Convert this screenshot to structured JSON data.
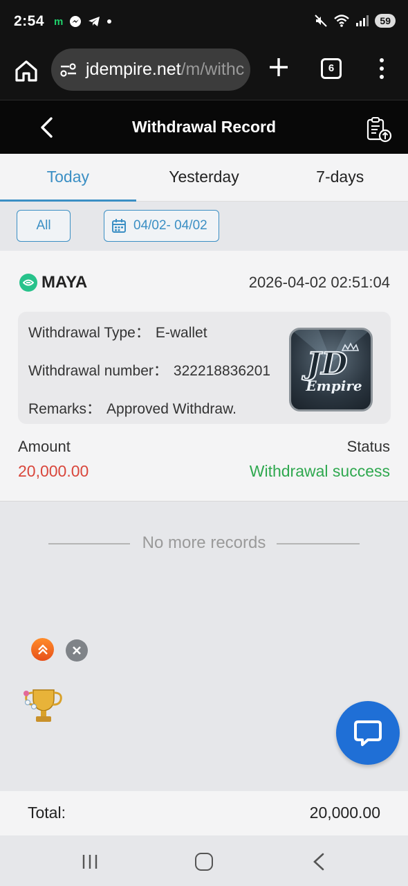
{
  "status_bar": {
    "time": "2:54",
    "app_icons": [
      "m",
      "messenger-icon",
      "telegram-icon",
      "dot"
    ],
    "battery": "59"
  },
  "browser": {
    "url_domain": "jdempire.net",
    "url_path": "/m/withc",
    "tab_count": "6"
  },
  "header": {
    "title": "Withdrawal Record"
  },
  "tabs": [
    {
      "label": "Today",
      "active": true
    },
    {
      "label": "Yesterday",
      "active": false
    },
    {
      "label": "7-days",
      "active": false
    }
  ],
  "filters": {
    "all_label": "All",
    "date_range": "04/02- 04/02"
  },
  "record": {
    "provider": "MAYA",
    "datetime": "2026-04-02 02:51:04",
    "type_label": "Withdrawal Type：",
    "type_value": "E-wallet",
    "number_label": "Withdrawal number：",
    "number_value": "322218836201",
    "remarks_label": "Remarks：",
    "remarks_value": "Approved Withdraw.",
    "amount_label": "Amount",
    "amount_value": "20,000.00",
    "status_label": "Status",
    "status_value": "Withdrawal success"
  },
  "logo": {
    "line1": "JD",
    "line2": "Empire"
  },
  "no_more": "No more records",
  "total": {
    "label": "Total:",
    "value": "20,000.00"
  },
  "colors": {
    "accent": "#3b8fc4",
    "amount": "#d9463b",
    "success": "#2fa84f",
    "chat": "#1f6fd6"
  }
}
